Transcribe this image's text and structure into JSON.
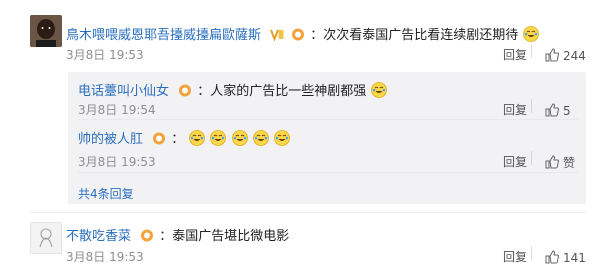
{
  "comments": [
    {
      "author": "鳥木喂喂威恩耶吾擡威擡扁歐薩斯",
      "text": "：次次看泰国广告比看连续剧还期待",
      "time": "3月8日 19:53",
      "reply_label": "回复",
      "likes": "244"
    },
    {
      "author": "不散吃香菜",
      "text": "：泰国广告堪比微电影",
      "time": "3月8日 19:53",
      "reply_label": "回复",
      "likes": "141"
    }
  ],
  "replies": [
    {
      "author": "电话薹叫小仙女",
      "text": "：人家的广告比一些神剧都强",
      "time": "3月8日 19:54",
      "reply_label": "回复",
      "likes": "5"
    },
    {
      "author": "帅的被人肛",
      "text": "：",
      "time": "3月8日 19:53",
      "reply_label": "回复",
      "likes": "赞"
    }
  ],
  "more_replies": "共4条回复",
  "icons": {
    "badge": "vip-badge-icon",
    "emoji": "laugh-cry-emoji-icon",
    "like": "thumbs-up-icon"
  },
  "colors": {
    "link": "#2a6fbd",
    "reply_bg": "#f2f2f5"
  }
}
